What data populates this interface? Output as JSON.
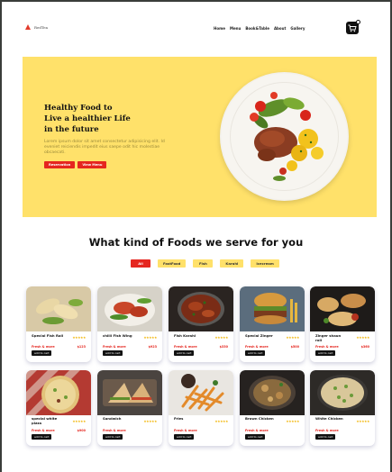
{
  "nav": {
    "logo": "RedTea",
    "links": [
      "Home",
      "Menu",
      "Book&Table",
      "About",
      "Gallery"
    ]
  },
  "hero": {
    "title_lines": [
      "Healthy Food to",
      "Live a healthier Life",
      "in the future"
    ],
    "description": "Lorem ipsum dolor sit amet consectetur adipisicing elit. Id eveniet reiciendis impedit eius saepe odit hic molestiae obcaecati.",
    "btn_primary": "Reservation",
    "btn_secondary": "View Menu"
  },
  "section": {
    "title": "What kind of Foods we serve for you",
    "filters": [
      "All",
      "FastFood",
      "Fish",
      "Karahi",
      "Icecream"
    ],
    "active_filter": "All"
  },
  "cards": [
    {
      "name": "Special Fish Roll",
      "stars": "★★★★★",
      "sub": "Fresh & more",
      "price": "$123",
      "btn": "add to cart"
    },
    {
      "name": "chilli Fish Wing",
      "stars": "★★★★★",
      "sub": "Fresh & more",
      "price": "$923",
      "btn": "add to cart"
    },
    {
      "name": "Fish Karahi",
      "stars": "★★★★★",
      "sub": "Fresh & more",
      "price": "$330",
      "btn": "add to cart"
    },
    {
      "name": "Special Zinger",
      "stars": "★★★★★",
      "sub": "Fresh & more",
      "price": "$500",
      "btn": "add to cart"
    },
    {
      "name": "Zinger shaun roll",
      "stars": "★★★★★",
      "sub": "Fresh & more",
      "price": "$360",
      "btn": "add to cart"
    },
    {
      "name": "special white pizza",
      "stars": "★★★★★",
      "sub": "Fresh & more",
      "price": "$900",
      "btn": "add to cart"
    },
    {
      "name": "Sandwich",
      "stars": "★★★★★",
      "sub": "Fresh & more",
      "price": "",
      "btn": "add to cart"
    },
    {
      "name": "Fries",
      "stars": "★★★★★",
      "sub": "Fresh & more",
      "price": "",
      "btn": "add to cart"
    },
    {
      "name": "Brown Chicken",
      "stars": "★★★★★",
      "sub": "Fresh & more",
      "price": "",
      "btn": "add to cart"
    },
    {
      "name": "White Chicken",
      "stars": "★★★★★",
      "sub": "Fresh & more",
      "price": "",
      "btn": "add to cart"
    }
  ],
  "colors": {
    "accent": "#e5261f",
    "hero_bg": "#ffe16a",
    "star": "#f2b400"
  }
}
